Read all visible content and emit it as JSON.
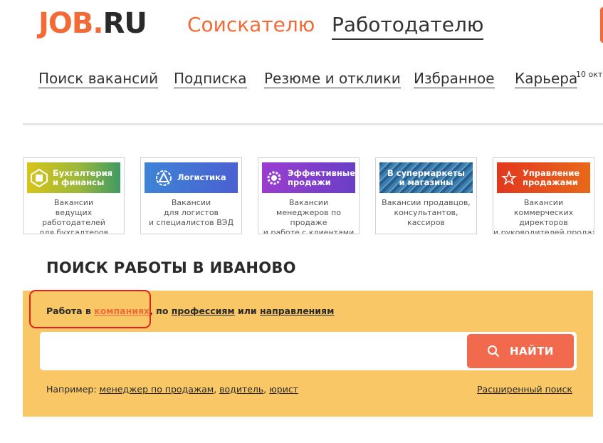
{
  "header": {
    "logo_job": "JOB",
    "logo_dot": ".",
    "logo_ru": "RU",
    "tab_seeker": "Соискателю",
    "tab_employer": "Работодателю"
  },
  "nav": {
    "items": [
      {
        "label": "Поиск вакансий"
      },
      {
        "label": "Подписка"
      },
      {
        "label": "Резюме и отклики"
      },
      {
        "label": "Избранное"
      },
      {
        "label": "Карьера"
      }
    ],
    "badge": "10 окт"
  },
  "cards": [
    {
      "title_line1": "Бухгалтерия",
      "title_line2": "и финансы",
      "desc_line1": "Вакансии",
      "desc_line2": "ведущих работодателей",
      "desc_line3": "для бухгалтеров",
      "desc_line4": "",
      "icon": "calculator-icon"
    },
    {
      "title_line1": "Логистика",
      "title_line2": "",
      "desc_line1": "Вакансии",
      "desc_line2": "для логистов",
      "desc_line3": "и специалистов ВЭД",
      "desc_line4": "",
      "icon": "logistics-icon"
    },
    {
      "title_line1": "Эффективные",
      "title_line2": "продажи",
      "desc_line1": "Вакансии",
      "desc_line2": "менеджеров по продаже",
      "desc_line3": "и работе с клиентами",
      "desc_line4": "",
      "icon": "gear-icon"
    },
    {
      "title_line1": "В супермаркеты",
      "title_line2": "и магазины",
      "desc_line1": "Вакансии продавцов,",
      "desc_line2": "консультантов,",
      "desc_line3": "кассиров",
      "desc_line4": "",
      "icon": "store-icon"
    },
    {
      "title_line1": "Управление",
      "title_line2": "продажами",
      "desc_line1": "Вакансии",
      "desc_line2": "коммерческих",
      "desc_line3": "директоров",
      "desc_line4": "и руководителей продаж",
      "icon": "star-icon"
    }
  ],
  "search": {
    "heading": "ПОИСК РАБОТЫ В ИВАНОВО",
    "filters_prefix": "Работа в ",
    "filter_companies": "компаниях",
    "filters_mid": ", по ",
    "filter_professions": "профессиям",
    "filters_or": " или ",
    "filter_directions": "направлениям",
    "input_value": "",
    "input_placeholder": "",
    "button_label": "НАЙТИ",
    "examples_prefix": "Например: ",
    "example_1": "менеджер по продажам",
    "example_2": "водитель",
    "example_3": "юрист",
    "advanced_label": "Расширенный поиск"
  },
  "colors": {
    "brand": "#f26a35",
    "panel": "#fac766",
    "button": "#f26a4e",
    "highlight": "#e3201a"
  }
}
